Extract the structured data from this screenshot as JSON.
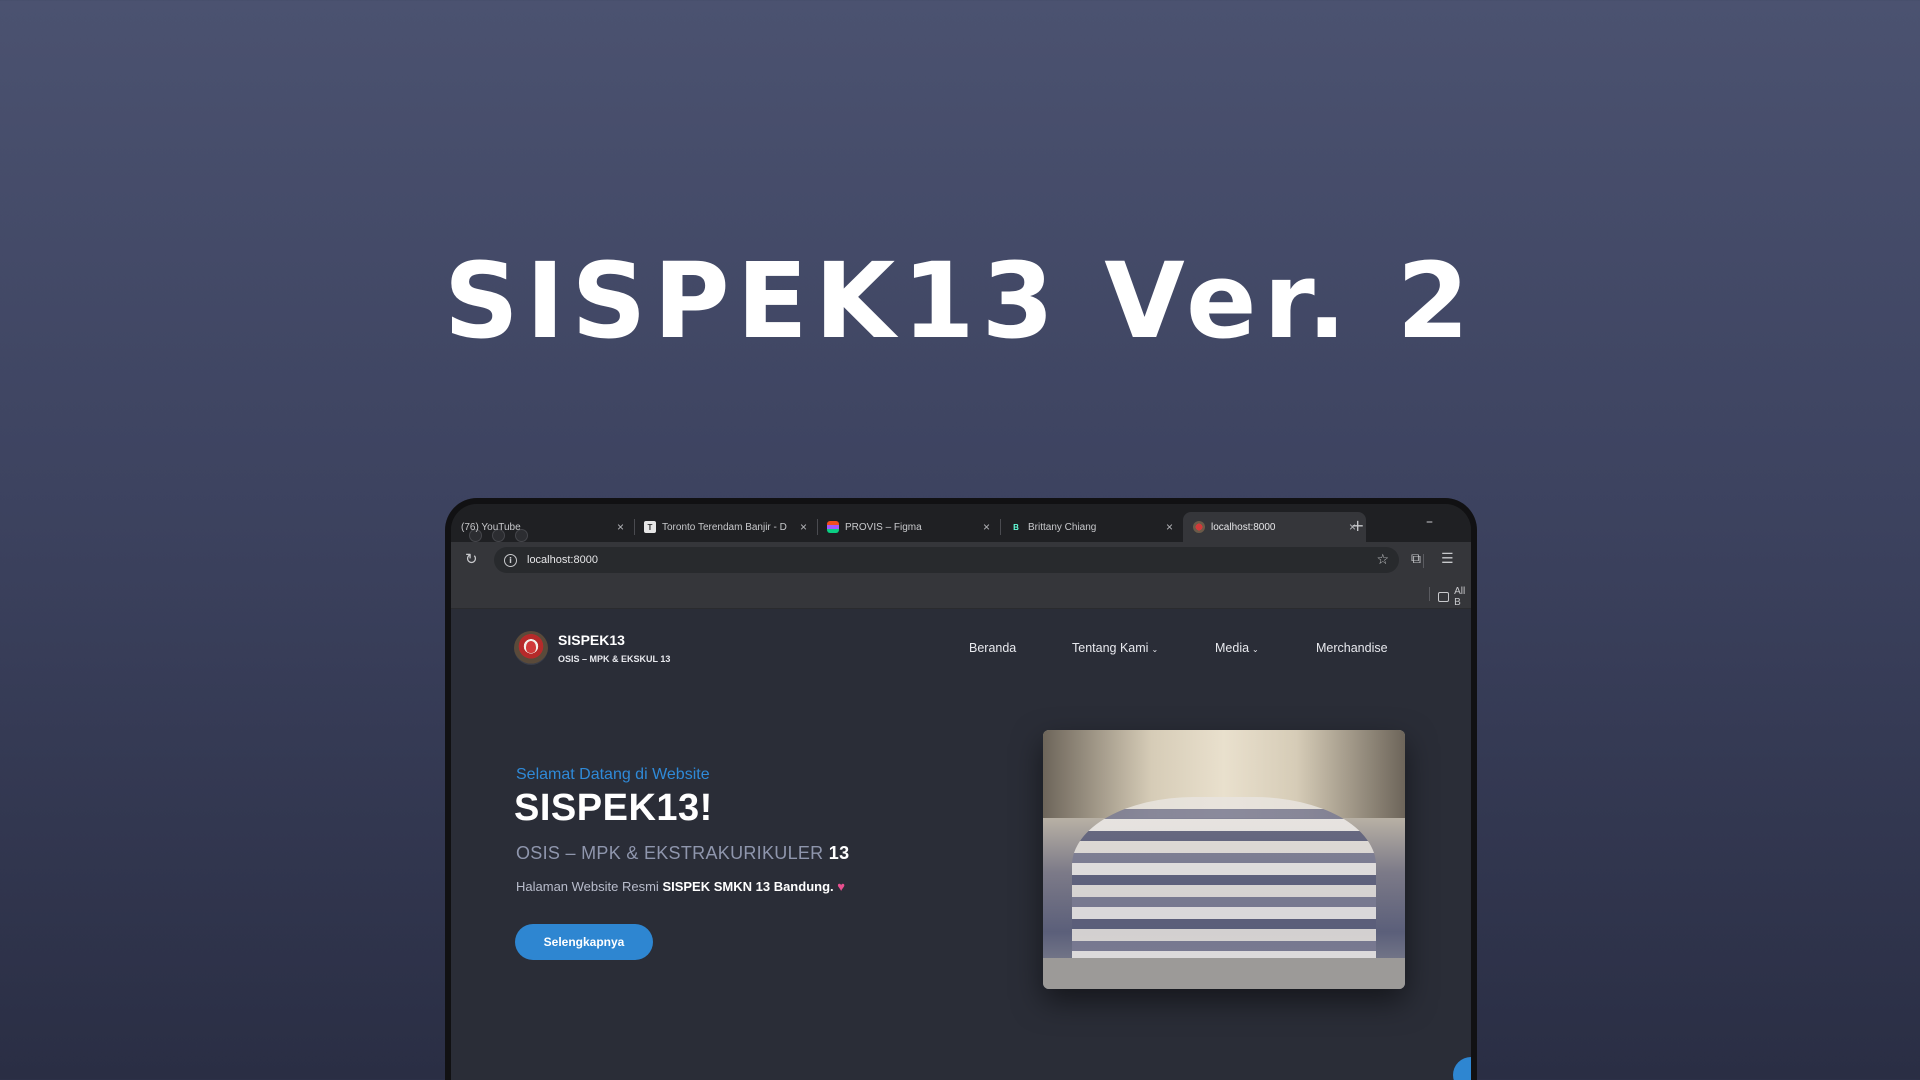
{
  "headline": "SISPEK13 Ver. 2",
  "browser": {
    "tabs": [
      {
        "title": "(76) YouTube",
        "favicon": "youtube-icon"
      },
      {
        "title": "Toronto Terendam Banjir - D",
        "favicon": "page-icon"
      },
      {
        "title": "PROVIS – Figma",
        "favicon": "figma-icon"
      },
      {
        "title": "Brittany Chiang",
        "favicon": "b-icon"
      },
      {
        "title": "localhost:8000",
        "favicon": "sispek-icon"
      }
    ],
    "active_tab": 4,
    "address": "localhost:8000",
    "bookmarks_label": "All B"
  },
  "site": {
    "brand_name": "SISPEK13",
    "brand_sub": "OSIS – MPK & EKSKUL 13",
    "nav": [
      {
        "label": "Beranda",
        "dropdown": false
      },
      {
        "label": "Tentang Kami",
        "dropdown": true
      },
      {
        "label": "Media",
        "dropdown": true
      },
      {
        "label": "Merchandise",
        "dropdown": false
      }
    ],
    "hero": {
      "welcome": "Selamat Datang di Website",
      "title": "SISPEK13!",
      "sub_prefix": "OSIS – MPK & EKSTRAKURIKULER",
      "sub_number": "13",
      "desc_prefix": "Halaman Website Resmi",
      "desc_bold": "SISPEK SMKN 13 Bandung.",
      "desc_heart": "♥",
      "cta": "Selengkapnya"
    }
  },
  "colors": {
    "accent": "#2e86d1",
    "page_bg": "#2a2d37",
    "heart": "#e8508f"
  }
}
